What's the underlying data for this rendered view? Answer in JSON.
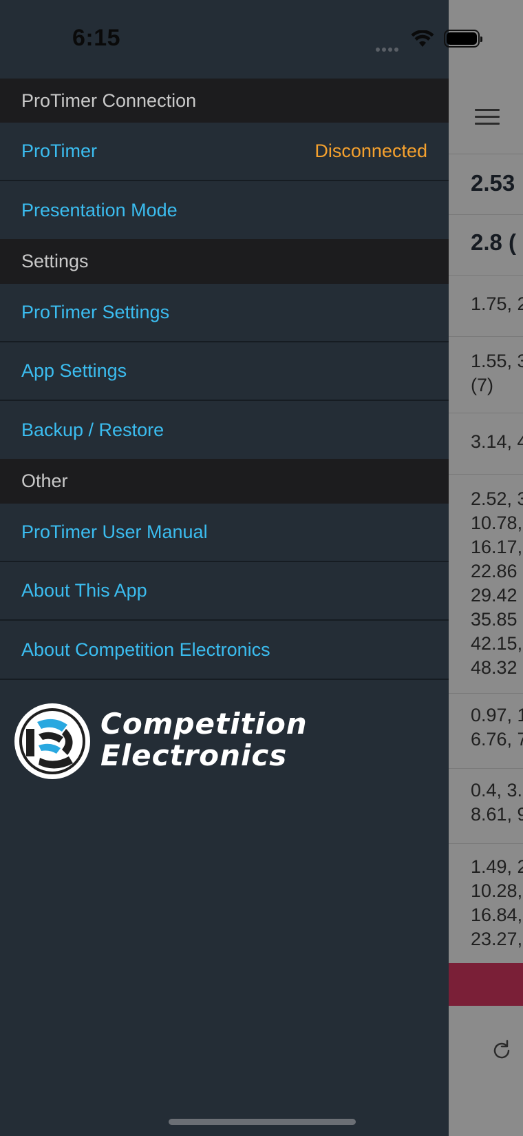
{
  "status_bar": {
    "time": "6:15"
  },
  "drawer": {
    "sections": [
      {
        "header": "ProTimer Connection"
      },
      {
        "header": "Settings"
      },
      {
        "header": "Other"
      }
    ],
    "items": {
      "protimer": {
        "label": "ProTimer",
        "value": "Disconnected"
      },
      "presentation_mode": {
        "label": "Presentation Mode"
      },
      "protimer_settings": {
        "label": "ProTimer Settings"
      },
      "app_settings": {
        "label": "App Settings"
      },
      "backup_restore": {
        "label": "Backup / Restore"
      },
      "user_manual": {
        "label": "ProTimer User Manual"
      },
      "about_app": {
        "label": "About This App"
      },
      "about_ce": {
        "label": "About Competition Electronics"
      }
    },
    "logo": {
      "line1": "Competition",
      "line2": "Electronics"
    }
  },
  "background_app": {
    "rows": [
      {
        "text": "2.53",
        "bold": true
      },
      {
        "text": "2.8 (",
        "bold": true
      },
      {
        "text": "1.75, 2"
      },
      {
        "text": "1.55, 3\n(7)"
      },
      {
        "text": "3.14, 4"
      },
      {
        "text": "2.52, 3\n10.78,\n16.17,\n22.86\n29.42\n35.85\n42.15,\n48.32"
      },
      {
        "text": "0.97, 1\n6.76, 7"
      },
      {
        "text": "0.4, 3.\n8.61, 9"
      },
      {
        "text": "1.49, 2\n10.28,\n16.84,\n23.27,"
      }
    ]
  },
  "colors": {
    "drawer_bg": "#242d36",
    "section_bg": "#1c1c1e",
    "link": "#3bbdf0",
    "status_warning": "#f5a12e",
    "accent_bar": "#7a1f37"
  }
}
